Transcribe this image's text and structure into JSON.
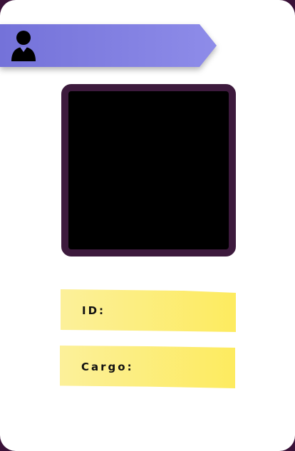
{
  "badge": {
    "header_icon": "user-icon",
    "photo_frame_color": "#3d1a3d",
    "banner_color_start": "#7472d9",
    "banner_color_end": "#8e8ce9",
    "note_color": "#fdeb5f"
  },
  "fields": {
    "id_label": "ID:",
    "cargo_label": "Cargo:"
  }
}
